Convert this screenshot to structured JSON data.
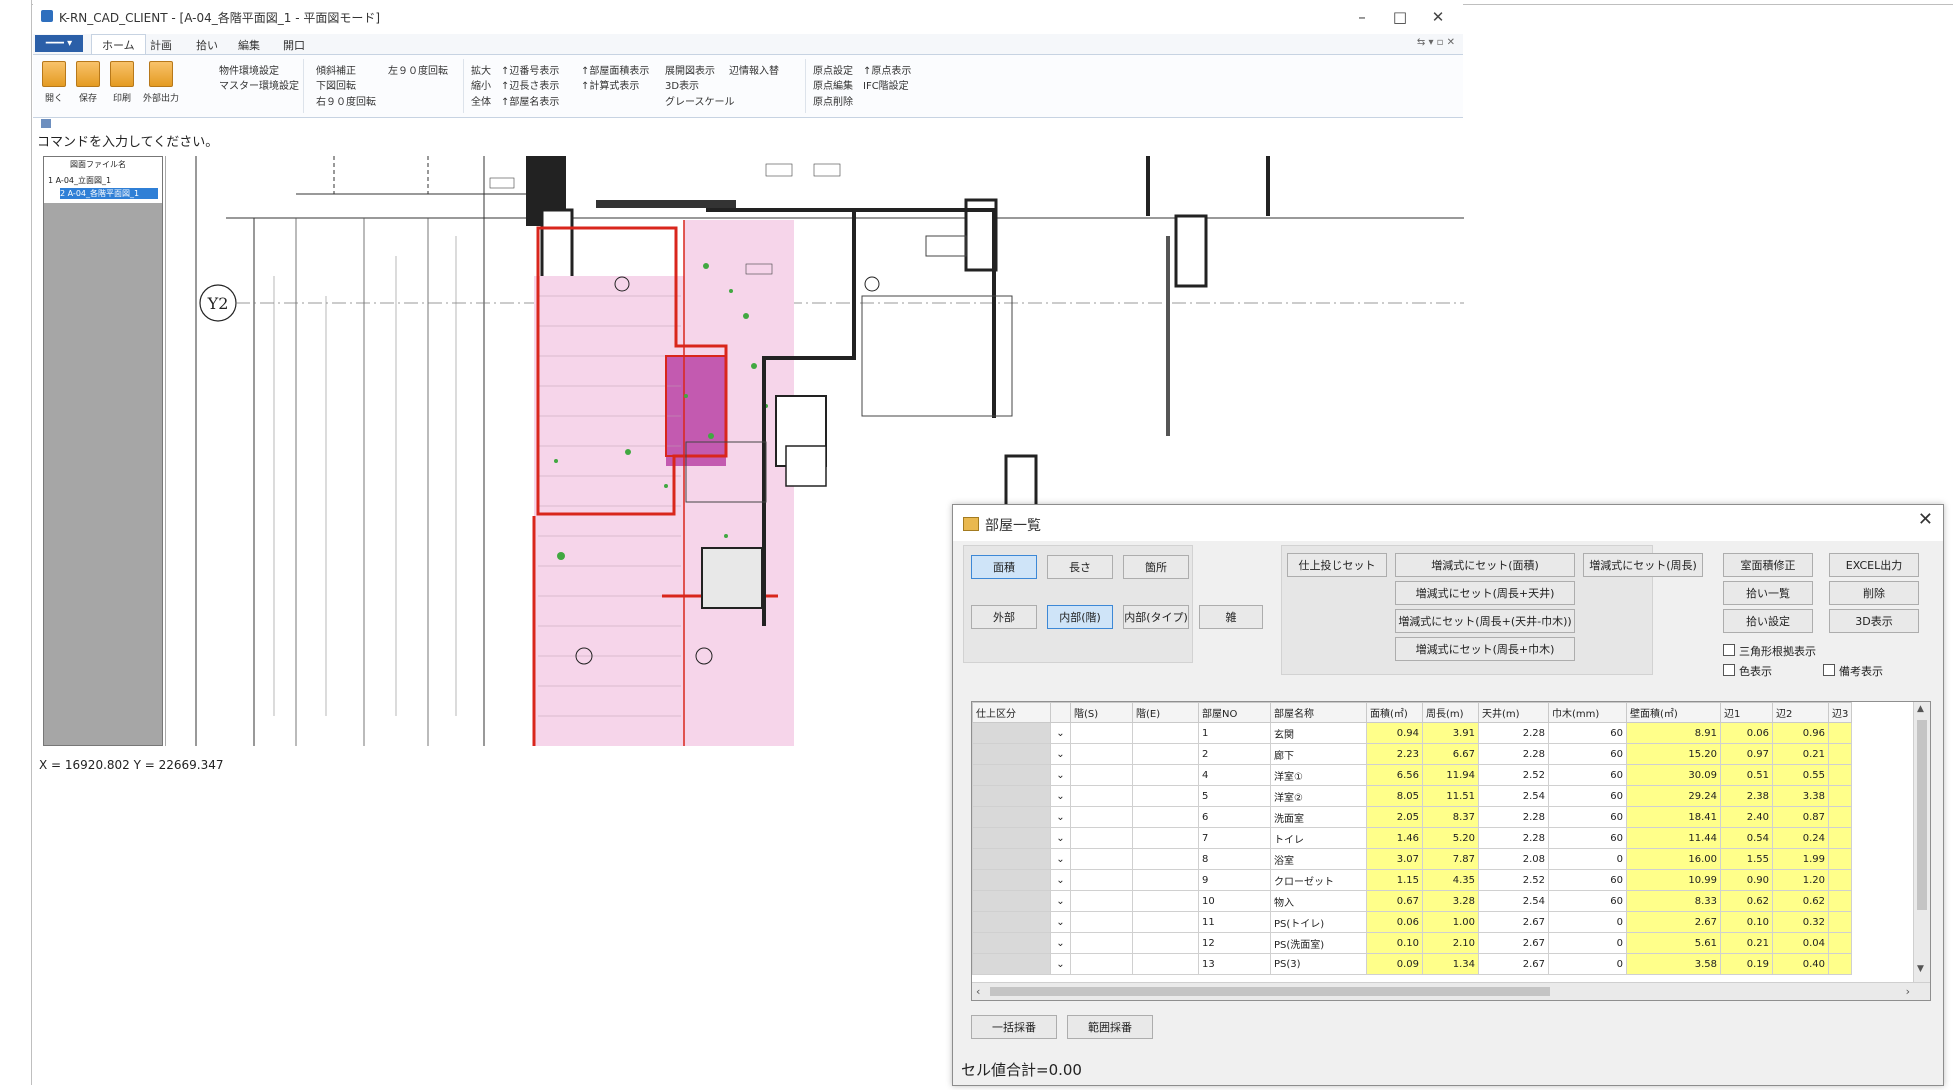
{
  "main_window": {
    "title": "K-RN_CAD_CLIENT - [A-04_各階平面図_1 - 平面図モード]",
    "window_controls": [
      "–",
      "□",
      "✕"
    ],
    "file_tab": "━━━  ▾",
    "ribbon_tabs": [
      "ホーム",
      "計画",
      "拾い",
      "編集",
      "開口"
    ],
    "ribbon_right": "⇆ ▾ ▫ ✕",
    "ribbon": {
      "big_buttons": [
        "開く",
        "保存",
        "印刷",
        "外部出力"
      ],
      "group1": [
        "物件環境設定",
        "マスター環境設定"
      ],
      "group2": [
        "傾斜補正",
        "下図回転",
        "右９０度回転",
        "左９０度回転"
      ],
      "group3": [
        "拡大",
        "縮小",
        "全体",
        "↑辺番号表示",
        "↑辺長さ表示",
        "↑部屋名表示",
        "↑部屋面積表示",
        "↑計算式表示",
        "展開図表示",
        "3D表示",
        "グレースケール",
        "辺情報入替"
      ],
      "group4": [
        "原点設定",
        "原点編集",
        "原点削除",
        "↑原点表示",
        "IFC階設定"
      ]
    },
    "command_prompt": "コマンドを入力してください。",
    "tree": {
      "header": "図面ファイル名",
      "items": [
        "1 A-04_立面図_1",
        "2 A-04_各階平面図_1"
      ]
    },
    "grid_marker": "Y2",
    "status": "X = 16920.802 Y = 22669.347"
  },
  "dialog": {
    "title": "部屋一覧",
    "close": "✕",
    "mode_buttons": [
      "面積",
      "長さ",
      "箇所"
    ],
    "type_buttons": [
      "外部",
      "内部(階)",
      "内部(タイプ)",
      "雑"
    ],
    "set_buttons": [
      "仕上投じセット",
      "増減式にセット(面積)",
      "増減式にセット(周長)",
      "増減式にセット(周長+天井)",
      "増減式にセット(周長+(天井-巾木))",
      "増減式にセット(周長+巾木)"
    ],
    "right_buttons": [
      "室面積修正",
      "EXCEL出力",
      "拾い一覧",
      "削除",
      "拾い設定",
      "3D表示"
    ],
    "checkboxes": [
      "三角形根拠表示",
      "色表示",
      "備考表示"
    ],
    "columns": [
      "仕上区分",
      "階(S)",
      "階(E)",
      "部屋NO",
      "部屋名称",
      "面積(㎡)",
      "周長(m)",
      "天井(m)",
      "巾木(mm)",
      "壁面積(㎡)",
      "辺1",
      "辺2",
      "辺3"
    ],
    "rows": [
      [
        "",
        "",
        "",
        "1",
        "玄関",
        "0.94",
        "3.91",
        "2.28",
        "60",
        "8.91",
        "0.06",
        "0.96"
      ],
      [
        "",
        "",
        "",
        "2",
        "廊下",
        "2.23",
        "6.67",
        "2.28",
        "60",
        "15.20",
        "0.97",
        "0.21"
      ],
      [
        "",
        "",
        "",
        "4",
        "洋室①",
        "6.56",
        "11.94",
        "2.52",
        "60",
        "30.09",
        "0.51",
        "0.55"
      ],
      [
        "",
        "",
        "",
        "5",
        "洋室②",
        "8.05",
        "11.51",
        "2.54",
        "60",
        "29.24",
        "2.38",
        "3.38"
      ],
      [
        "",
        "",
        "",
        "6",
        "洗面室",
        "2.05",
        "8.37",
        "2.28",
        "60",
        "18.41",
        "2.40",
        "0.87"
      ],
      [
        "",
        "",
        "",
        "7",
        "トイレ",
        "1.46",
        "5.20",
        "2.28",
        "60",
        "11.44",
        "0.54",
        "0.24"
      ],
      [
        "",
        "",
        "",
        "8",
        "浴室",
        "3.07",
        "7.87",
        "2.08",
        "0",
        "16.00",
        "1.55",
        "1.99"
      ],
      [
        "",
        "",
        "",
        "9",
        "クローゼット",
        "1.15",
        "4.35",
        "2.52",
        "60",
        "10.99",
        "0.90",
        "1.20"
      ],
      [
        "",
        "",
        "",
        "10",
        "物入",
        "0.67",
        "3.28",
        "2.54",
        "60",
        "8.33",
        "0.62",
        "0.62"
      ],
      [
        "",
        "",
        "",
        "11",
        "PS(トイレ)",
        "0.06",
        "1.00",
        "2.67",
        "0",
        "2.67",
        "0.10",
        "0.32"
      ],
      [
        "",
        "",
        "",
        "12",
        "PS(洗面室)",
        "0.10",
        "2.10",
        "2.67",
        "0",
        "5.61",
        "0.21",
        "0.04"
      ],
      [
        "",
        "",
        "",
        "13",
        "PS(3)",
        "0.09",
        "1.34",
        "2.67",
        "0",
        "3.58",
        "0.19",
        "0.40"
      ]
    ],
    "bottom_buttons": [
      "一括採番",
      "範囲採番"
    ],
    "cell_total": "セル値合計=0.00"
  }
}
